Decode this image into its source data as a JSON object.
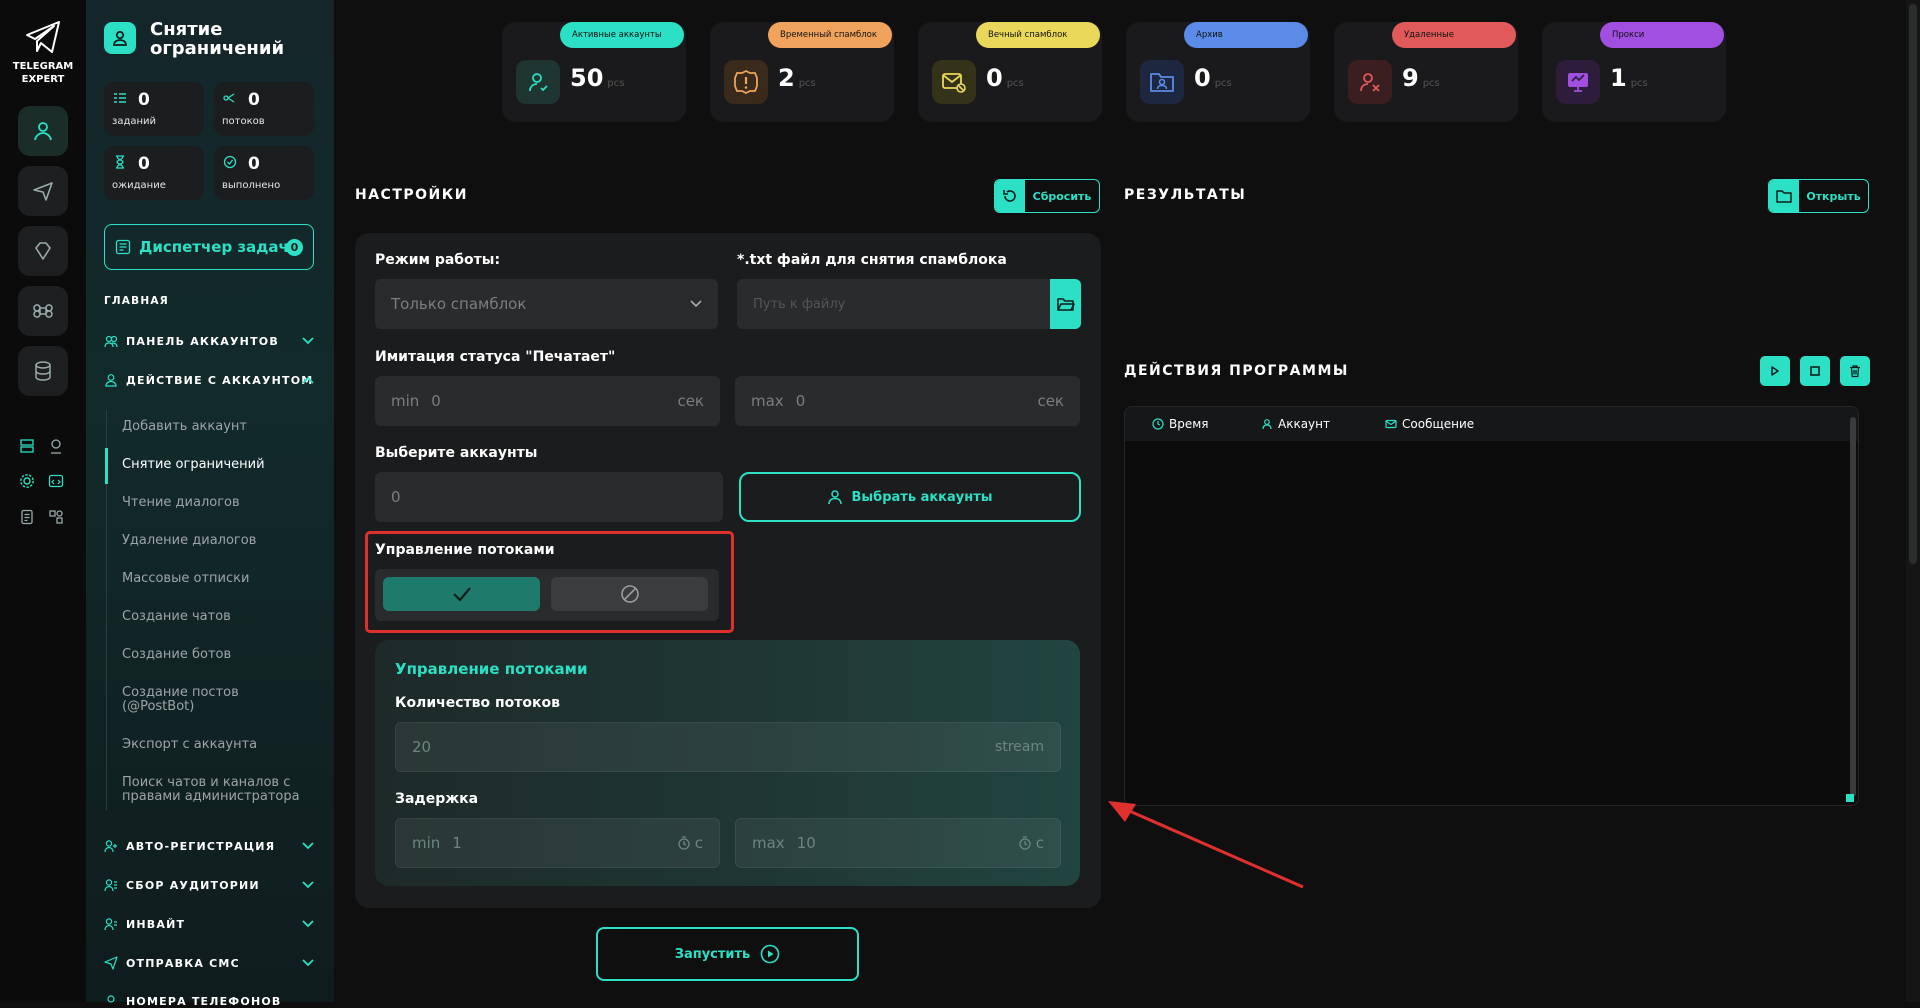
{
  "app": {
    "logo_line1": "TELEGRAM",
    "logo_line2": "EXPERT"
  },
  "rail": {
    "icons": [
      "user-icon",
      "paper-plane-icon",
      "diamond-icon",
      "command-icon",
      "database-icon"
    ]
  },
  "sidebar": {
    "title_line1": "Снятие",
    "title_line2": "ограничений",
    "stats": [
      {
        "value": "0",
        "label": "заданий"
      },
      {
        "value": "0",
        "label": "потоков"
      },
      {
        "value": "0",
        "label": "ожидание"
      },
      {
        "value": "0",
        "label": "выполнено"
      }
    ],
    "dispatcher_label": "Диспетчер задач",
    "dispatcher_count": "0",
    "section_main": "ГЛАВНАЯ",
    "nav_accounts_panel": "ПАНЕЛЬ АККАУНТОВ",
    "nav_account_action": "ДЕЙСТВИЕ С АККАУНТОМ",
    "sub_items": [
      "Добавить аккаунт",
      "Снятие ограничений",
      "Чтение диалогов",
      "Удаление диалогов",
      "Массовые отписки",
      "Создание чатов",
      "Создание ботов",
      "Создание постов (@PostBot)",
      "Экспорт с аккаунта",
      "Поиск чатов и каналов с правами администратора"
    ],
    "nav_bottom": [
      "АВТО-РЕГИСТРАЦИЯ",
      "СБОР АУДИТОРИИ",
      "ИНВАЙТ",
      "ОТПРАВКА СМС",
      "НОМЕРА ТЕЛЕФОНОВ"
    ]
  },
  "status_cards": [
    {
      "badge": "Активные аккаунты",
      "value": "50",
      "unit": "pcs",
      "color": "#2be0c5"
    },
    {
      "badge": "Временный спамблок",
      "value": "2",
      "unit": "pcs",
      "color": "#f0a35c"
    },
    {
      "badge": "Вечный спамблок",
      "value": "0",
      "unit": "pcs",
      "color": "#e9d85a"
    },
    {
      "badge": "Архив",
      "value": "0",
      "unit": "pcs",
      "color": "#5b8be8"
    },
    {
      "badge": "Удаленные",
      "value": "9",
      "unit": "pcs",
      "color": "#e05a5a"
    },
    {
      "badge": "Прокси",
      "value": "1",
      "unit": "pcs",
      "color": "#a04fe0"
    }
  ],
  "settings": {
    "title": "НАСТРОЙКИ",
    "reset_label": "Сбросить",
    "mode_label": "Режим работы:",
    "mode_value": "Только спамблок",
    "file_label": "*.txt файл для снятия спамблока",
    "file_placeholder": "Путь к файлу",
    "typing_label": "Имитация статуса \"Печатает\"",
    "typing_min_prefix": "min",
    "typing_min_value": "0",
    "typing_max_prefix": "max",
    "typing_max_value": "0",
    "typing_unit": "сек",
    "accounts_label": "Выберите аккаунты",
    "accounts_value": "0",
    "choose_accounts_label": "Выбрать аккаунты",
    "threads_toggle_label": "Управление потоками",
    "threads_panel_title": "Управление потоками",
    "threads_count_label": "Количество потоков",
    "threads_count_value": "20",
    "threads_count_unit": "stream",
    "delay_label": "Задержка",
    "delay_min_prefix": "min",
    "delay_min_value": "1",
    "delay_max_prefix": "max",
    "delay_max_value": "10",
    "delay_unit": "с",
    "start_label": "Запустить"
  },
  "results": {
    "title": "РЕЗУЛЬТАТЫ",
    "open_label": "Открыть"
  },
  "actions": {
    "title": "ДЕЙСТВИЯ ПРОГРАММЫ",
    "col_time": "Время",
    "col_account": "Аккаунт",
    "col_message": "Сообщение"
  },
  "colors": {
    "accent": "#2be0c5",
    "highlight": "#e0302e"
  }
}
